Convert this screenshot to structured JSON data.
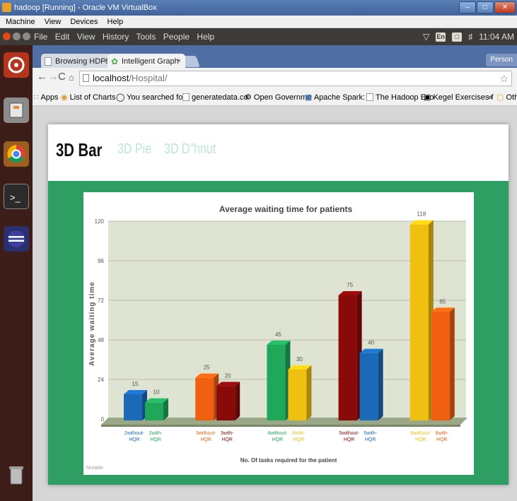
{
  "window": {
    "title": "hadoop [Running] - Oracle VM VirtualBox",
    "menu": [
      "Machine",
      "View",
      "Devices",
      "Help"
    ]
  },
  "ubuntu_panel": {
    "menus": [
      "File",
      "Edit",
      "View",
      "History",
      "Tools",
      "People",
      "Help"
    ],
    "keyboard": "En",
    "clock": "11:04 AM"
  },
  "browser": {
    "tabs": [
      {
        "label": "Browsing HDFS"
      },
      {
        "label": "Intelligent Graph"
      }
    ],
    "person_label": "Person",
    "url_host": "localhost",
    "url_path": "/Hospital/",
    "bookmarks": [
      "Apps",
      "List of Charts",
      "You searched for",
      "generatedata.co",
      "Open Governme",
      "Apache Spark: In",
      "The Hadoop Eco",
      "Kegel Exercises f",
      "»",
      "Other bookmark"
    ]
  },
  "page": {
    "tabs": [
      "3D Bar",
      "3D Pie",
      "3D D\"hnut"
    ]
  },
  "chart_data": {
    "type": "bar",
    "title": "Average waiting time for patients",
    "xlabel": "No. Of tasks required for the patient",
    "ylabel": "Average waiting time",
    "ylim": [
      0,
      120
    ],
    "yticks": [
      0,
      24,
      48,
      72,
      96,
      120
    ],
    "credit": "Nceptio",
    "bars": [
      {
        "label": "2without-HQR",
        "value": 15,
        "color": "#1a6ab8"
      },
      {
        "label": "2with-HQR",
        "value": 10,
        "color": "#1fa85a"
      },
      {
        "label": "3without-HQR",
        "value": 25,
        "color": "#f06010"
      },
      {
        "label": "3with-HQR",
        "value": 20,
        "color": "#8a0a0a"
      },
      {
        "label": "4without-HQR",
        "value": 45,
        "color": "#1fa85a"
      },
      {
        "label": "4with-HQR",
        "value": 30,
        "color": "#f0c010"
      },
      {
        "label": "5without-HQR",
        "value": 75,
        "color": "#8a0a0a"
      },
      {
        "label": "5with-HQR",
        "value": 40,
        "color": "#1a6ab8"
      },
      {
        "label": "6without-HQR",
        "value": 118,
        "color": "#f0c010"
      },
      {
        "label": "6with-HQR",
        "value": 65,
        "color": "#f06010"
      }
    ],
    "legend": false,
    "grid": true
  }
}
